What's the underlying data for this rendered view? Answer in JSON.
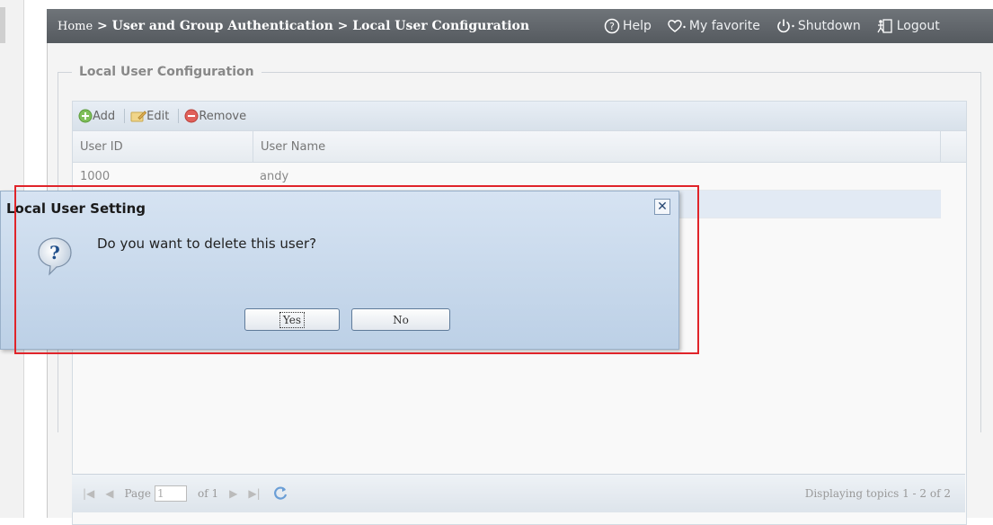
{
  "breadcrumb": {
    "home": "Home",
    "sep1": " > ",
    "section": "User and Group Authentication",
    "sep2": " > ",
    "page": "Local User Configuration"
  },
  "topnav": {
    "help": "Help",
    "favorite": "My favorite",
    "shutdown": "Shutdown",
    "logout": "Logout"
  },
  "panel": {
    "title": "Local User Configuration"
  },
  "toolbar": {
    "add": "Add",
    "edit": "Edit",
    "remove": "Remove"
  },
  "table": {
    "columns": [
      "User ID",
      "User Name"
    ],
    "rows": [
      {
        "id": "1000",
        "name": "andy"
      },
      {
        "id": "",
        "name": ""
      }
    ]
  },
  "pager": {
    "page_label": "Page",
    "page_value": "1",
    "of_label": "of 1",
    "display": "Displaying topics 1 - 2 of 2"
  },
  "dialog": {
    "title": "Local User Setting",
    "message": "Do you want to delete this user?",
    "yes": "Yes",
    "no": "No"
  },
  "colors": {
    "highlight": "#e0242a",
    "topbar": "#5f6469",
    "dialog_bg": "#c9d9eb"
  }
}
